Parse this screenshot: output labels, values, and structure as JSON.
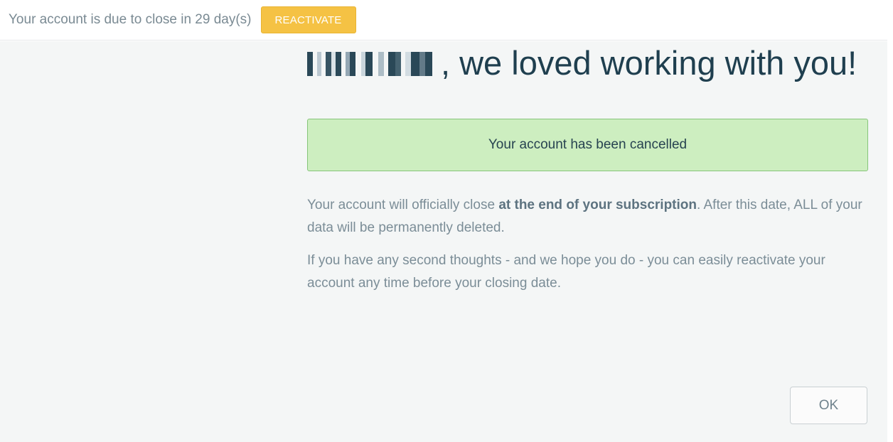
{
  "topbar": {
    "notice": "Your account is due to close in 29 day(s)",
    "reactivate_label": "REACTIVATE"
  },
  "main": {
    "heading_suffix": ", we loved working with you!",
    "alert_text": "Your account has been cancelled",
    "para1": {
      "before": "Your account will officially close ",
      "bold": "at the end of your subscription",
      "after": ". After this date, ALL of your data will be permanently deleted."
    },
    "para2": "If you have any second thoughts - and we hope you do - you can easily reactivate your account any time before your closing date.",
    "ok_label": "OK"
  },
  "colors": {
    "accent_yellow": "#f5c244",
    "success_bg": "#cdeec0",
    "heading": "#1f3f4f"
  }
}
